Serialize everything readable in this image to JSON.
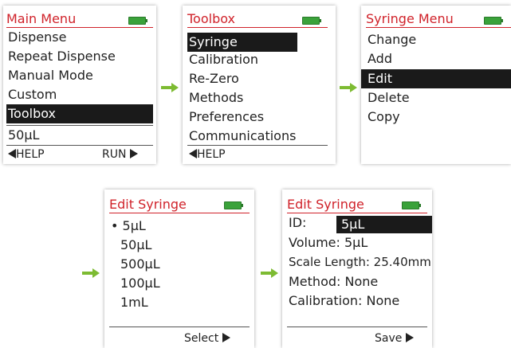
{
  "screens": {
    "main_menu": {
      "title": "Main Menu",
      "items": [
        "Dispense",
        "Repeat Dispense",
        "Manual Mode",
        "Custom",
        "Toolbox"
      ],
      "status": "50µL",
      "help": "HELP",
      "run": "RUN"
    },
    "toolbox": {
      "title": "Toolbox",
      "items": [
        "Syringe",
        "Calibration",
        "Re-Zero",
        "Methods",
        "Preferences",
        "Communications"
      ],
      "help": "HELP"
    },
    "syringe_menu": {
      "title": "Syringe Menu",
      "items": [
        "Change",
        "Add",
        "Edit",
        "Delete",
        "Copy"
      ]
    },
    "edit_syringe_list": {
      "title": "Edit Syringe",
      "bullet": "•",
      "items": [
        "5µL",
        "50µL",
        "500µL",
        "100µL",
        "1mL"
      ],
      "select": "Select"
    },
    "edit_syringe_detail": {
      "title": "Edit Syringe",
      "id_label": "ID:",
      "id_value": "5µL",
      "volume": "Volume: 5µL",
      "scale_length": "Scale Length: 25.40mm",
      "method": "Method: None",
      "calibration": "Calibration: None",
      "save": "Save"
    }
  },
  "colors": {
    "title": "#d0222a",
    "battery": "#3aa23a",
    "flow_arrow": "#7dbb32",
    "selection": "#1a1a1a"
  },
  "icons": [
    "battery-icon",
    "left-triangle-icon",
    "right-triangle-icon",
    "green-flow-arrow-icon"
  ]
}
